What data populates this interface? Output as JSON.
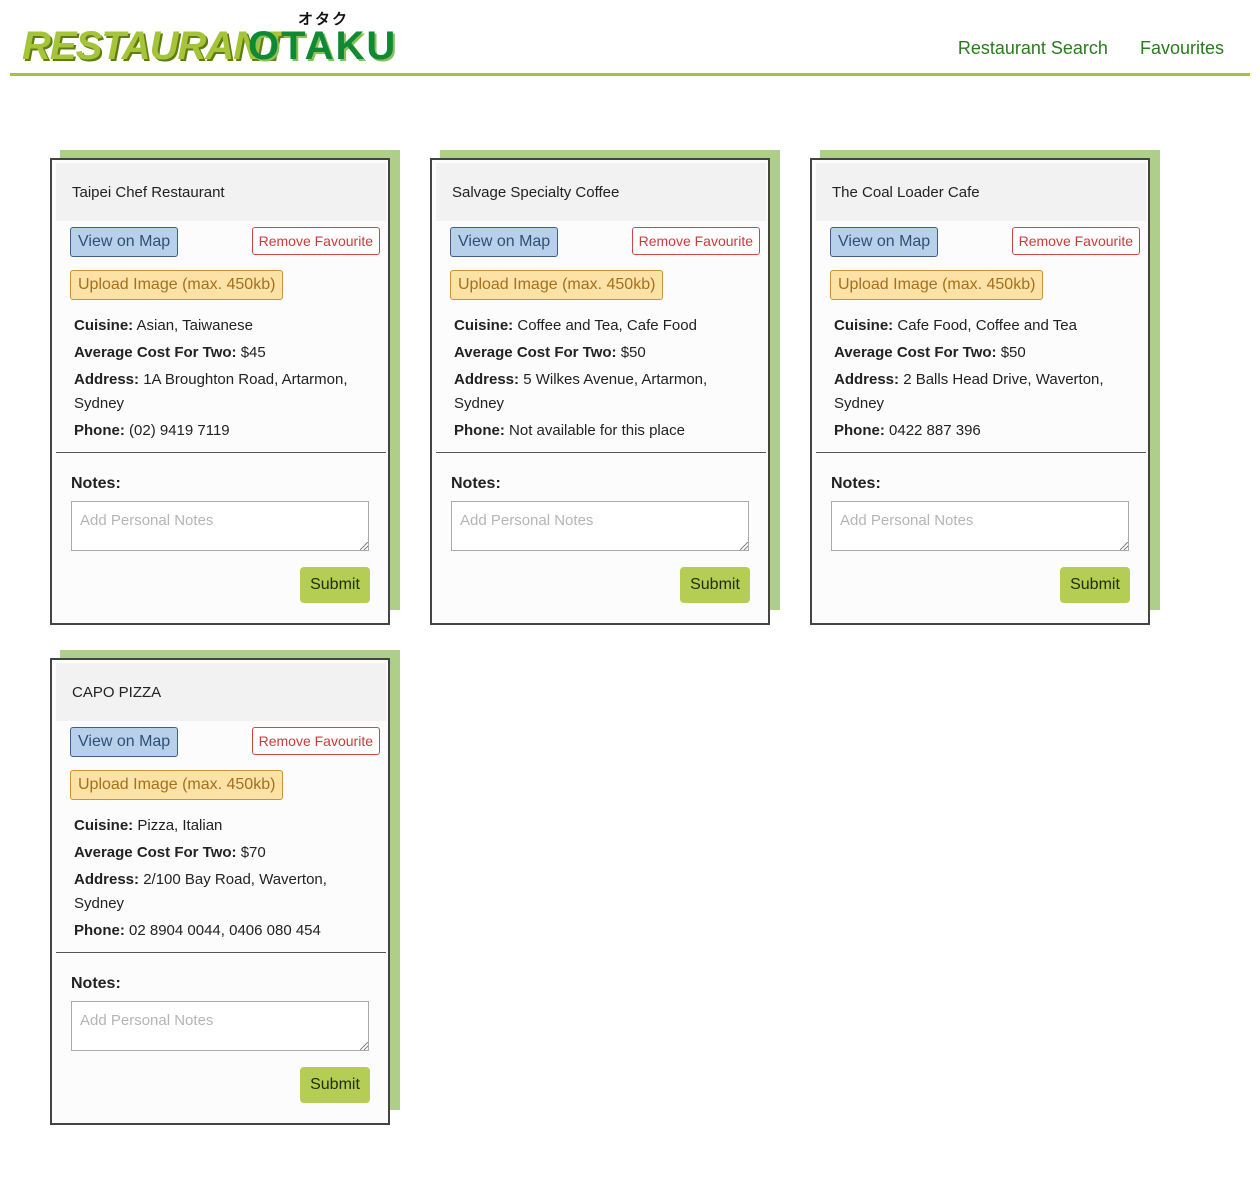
{
  "logo": {
    "kana": "オタク",
    "word1": "RESTAURANT",
    "word2": "OTAKU"
  },
  "nav": {
    "search": "Restaurant Search",
    "favourites": "Favourites"
  },
  "labels": {
    "view_on_map": "View on Map",
    "remove_favourite": "Remove Favourite",
    "upload_image": "Upload Image (max. 450kb)",
    "cuisine": "Cuisine:",
    "avg_cost": "Average Cost For Two:",
    "address": "Address:",
    "phone": "Phone:",
    "notes": "Notes:",
    "notes_placeholder": "Add Personal Notes",
    "submit": "Submit"
  },
  "cards": [
    {
      "name": "Taipei Chef Restaurant",
      "cuisine": "Asian, Taiwanese",
      "cost": "$45",
      "address": "1A Broughton Road, Artarmon, Sydney",
      "phone": "(02) 9419 7119"
    },
    {
      "name": "Salvage Specialty Coffee",
      "cuisine": "Coffee and Tea, Cafe Food",
      "cost": "$50",
      "address": "5 Wilkes Avenue, Artarmon, Sydney",
      "phone": "Not available for this place"
    },
    {
      "name": "The Coal Loader Cafe",
      "cuisine": "Cafe Food, Coffee and Tea",
      "cost": "$50",
      "address": "2 Balls Head Drive, Waverton, Sydney",
      "phone": "0422 887 396"
    },
    {
      "name": "CAPO PIZZA",
      "cuisine": "Pizza, Italian",
      "cost": "$70",
      "address": "2/100 Bay Road, Waverton, Sydney",
      "phone": "02 8904 0044, 0406 080 454"
    }
  ],
  "colors": {
    "accent": "#a6c43a",
    "nav_link": "#2a7a1e",
    "card_shadow": "#aecf8a",
    "submit": "#b5cc55"
  }
}
